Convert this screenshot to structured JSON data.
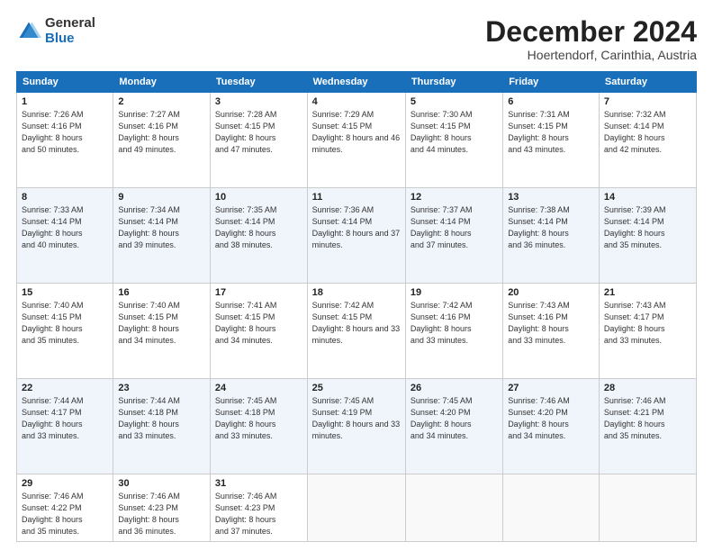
{
  "logo": {
    "general": "General",
    "blue": "Blue"
  },
  "header": {
    "month": "December 2024",
    "location": "Hoertendorf, Carinthia, Austria"
  },
  "weekdays": [
    "Sunday",
    "Monday",
    "Tuesday",
    "Wednesday",
    "Thursday",
    "Friday",
    "Saturday"
  ],
  "weeks": [
    [
      {
        "day": "1",
        "sunrise": "7:26 AM",
        "sunset": "4:16 PM",
        "daylight": "8 hours and 50 minutes."
      },
      {
        "day": "2",
        "sunrise": "7:27 AM",
        "sunset": "4:16 PM",
        "daylight": "8 hours and 49 minutes."
      },
      {
        "day": "3",
        "sunrise": "7:28 AM",
        "sunset": "4:15 PM",
        "daylight": "8 hours and 47 minutes."
      },
      {
        "day": "4",
        "sunrise": "7:29 AM",
        "sunset": "4:15 PM",
        "daylight": "8 hours and 46 minutes."
      },
      {
        "day": "5",
        "sunrise": "7:30 AM",
        "sunset": "4:15 PM",
        "daylight": "8 hours and 44 minutes."
      },
      {
        "day": "6",
        "sunrise": "7:31 AM",
        "sunset": "4:15 PM",
        "daylight": "8 hours and 43 minutes."
      },
      {
        "day": "7",
        "sunrise": "7:32 AM",
        "sunset": "4:14 PM",
        "daylight": "8 hours and 42 minutes."
      }
    ],
    [
      {
        "day": "8",
        "sunrise": "7:33 AM",
        "sunset": "4:14 PM",
        "daylight": "8 hours and 40 minutes."
      },
      {
        "day": "9",
        "sunrise": "7:34 AM",
        "sunset": "4:14 PM",
        "daylight": "8 hours and 39 minutes."
      },
      {
        "day": "10",
        "sunrise": "7:35 AM",
        "sunset": "4:14 PM",
        "daylight": "8 hours and 38 minutes."
      },
      {
        "day": "11",
        "sunrise": "7:36 AM",
        "sunset": "4:14 PM",
        "daylight": "8 hours and 37 minutes."
      },
      {
        "day": "12",
        "sunrise": "7:37 AM",
        "sunset": "4:14 PM",
        "daylight": "8 hours and 37 minutes."
      },
      {
        "day": "13",
        "sunrise": "7:38 AM",
        "sunset": "4:14 PM",
        "daylight": "8 hours and 36 minutes."
      },
      {
        "day": "14",
        "sunrise": "7:39 AM",
        "sunset": "4:14 PM",
        "daylight": "8 hours and 35 minutes."
      }
    ],
    [
      {
        "day": "15",
        "sunrise": "7:40 AM",
        "sunset": "4:15 PM",
        "daylight": "8 hours and 35 minutes."
      },
      {
        "day": "16",
        "sunrise": "7:40 AM",
        "sunset": "4:15 PM",
        "daylight": "8 hours and 34 minutes."
      },
      {
        "day": "17",
        "sunrise": "7:41 AM",
        "sunset": "4:15 PM",
        "daylight": "8 hours and 34 minutes."
      },
      {
        "day": "18",
        "sunrise": "7:42 AM",
        "sunset": "4:15 PM",
        "daylight": "8 hours and 33 minutes."
      },
      {
        "day": "19",
        "sunrise": "7:42 AM",
        "sunset": "4:16 PM",
        "daylight": "8 hours and 33 minutes."
      },
      {
        "day": "20",
        "sunrise": "7:43 AM",
        "sunset": "4:16 PM",
        "daylight": "8 hours and 33 minutes."
      },
      {
        "day": "21",
        "sunrise": "7:43 AM",
        "sunset": "4:17 PM",
        "daylight": "8 hours and 33 minutes."
      }
    ],
    [
      {
        "day": "22",
        "sunrise": "7:44 AM",
        "sunset": "4:17 PM",
        "daylight": "8 hours and 33 minutes."
      },
      {
        "day": "23",
        "sunrise": "7:44 AM",
        "sunset": "4:18 PM",
        "daylight": "8 hours and 33 minutes."
      },
      {
        "day": "24",
        "sunrise": "7:45 AM",
        "sunset": "4:18 PM",
        "daylight": "8 hours and 33 minutes."
      },
      {
        "day": "25",
        "sunrise": "7:45 AM",
        "sunset": "4:19 PM",
        "daylight": "8 hours and 33 minutes."
      },
      {
        "day": "26",
        "sunrise": "7:45 AM",
        "sunset": "4:20 PM",
        "daylight": "8 hours and 34 minutes."
      },
      {
        "day": "27",
        "sunrise": "7:46 AM",
        "sunset": "4:20 PM",
        "daylight": "8 hours and 34 minutes."
      },
      {
        "day": "28",
        "sunrise": "7:46 AM",
        "sunset": "4:21 PM",
        "daylight": "8 hours and 35 minutes."
      }
    ],
    [
      {
        "day": "29",
        "sunrise": "7:46 AM",
        "sunset": "4:22 PM",
        "daylight": "8 hours and 35 minutes."
      },
      {
        "day": "30",
        "sunrise": "7:46 AM",
        "sunset": "4:23 PM",
        "daylight": "8 hours and 36 minutes."
      },
      {
        "day": "31",
        "sunrise": "7:46 AM",
        "sunset": "4:23 PM",
        "daylight": "8 hours and 37 minutes."
      },
      null,
      null,
      null,
      null
    ]
  ],
  "labels": {
    "sunrise": "Sunrise:",
    "sunset": "Sunset:",
    "daylight": "Daylight:"
  }
}
